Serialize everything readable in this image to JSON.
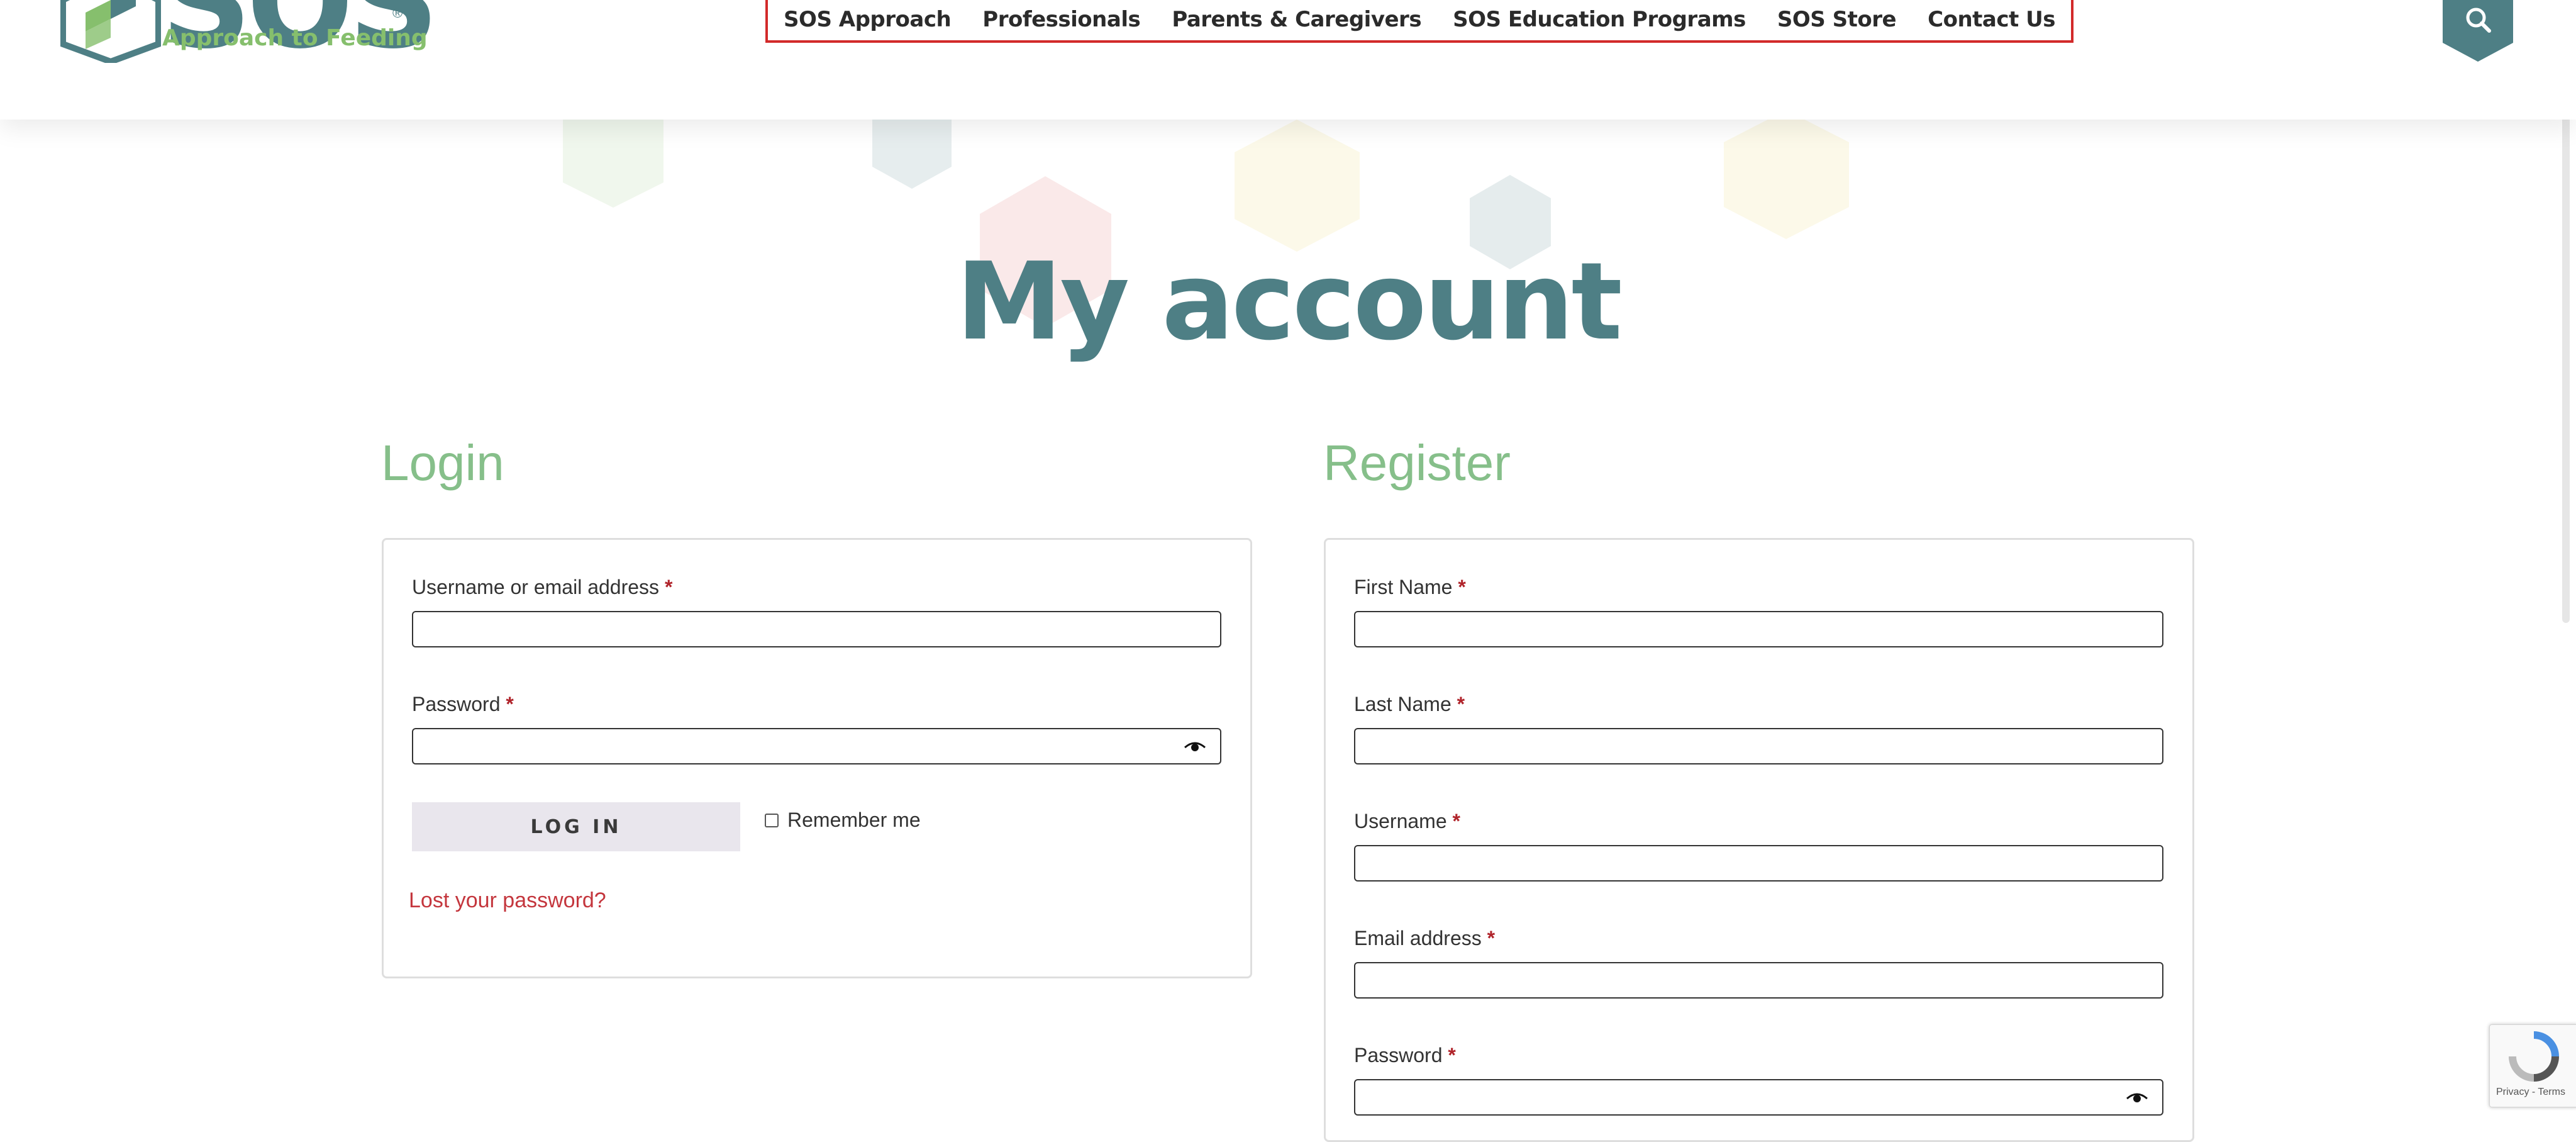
{
  "header": {
    "logo_word": "SOS",
    "logo_registered": "®",
    "logo_tagline": "Approach to Feeding",
    "nav": [
      "SOS Approach",
      "Professionals",
      "Parents & Caregivers",
      "SOS Education Programs",
      "SOS Store",
      "Contact Us"
    ]
  },
  "page": {
    "title": "My account"
  },
  "login": {
    "heading": "Login",
    "username_label": "Username or email address",
    "password_label": "Password",
    "required_mark": "*",
    "login_button": "LOG IN",
    "remember_label": "Remember me",
    "lost_password": "Lost your password?"
  },
  "register": {
    "heading": "Register",
    "first_name_label": "First Name",
    "last_name_label": "Last Name",
    "username_label": "Username",
    "email_label": "Email address",
    "password_label": "Password",
    "required_mark": "*"
  },
  "recaptcha": {
    "text": "Privacy - Terms"
  },
  "colors": {
    "brand_teal": "#4e7f85",
    "brand_green": "#86bf6d",
    "nav_highlight": "#d22a2a",
    "required": "#b0242b"
  }
}
